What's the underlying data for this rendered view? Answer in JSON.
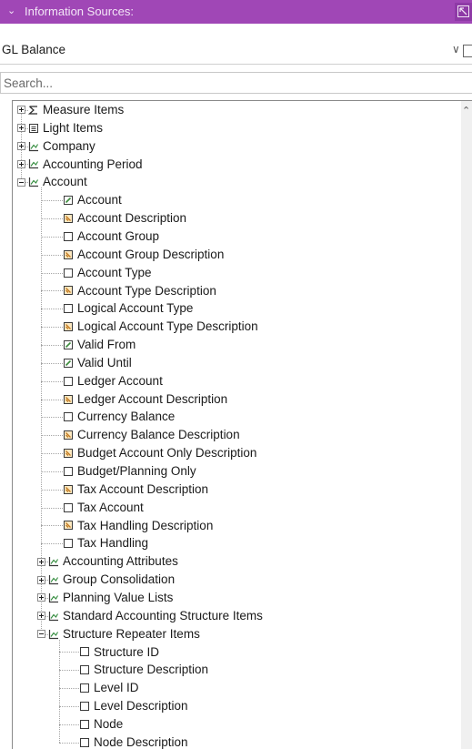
{
  "panel": {
    "title": "Information Sources:",
    "pin_icon": "pin-icon"
  },
  "source_dropdown": {
    "value": "GL Balance"
  },
  "search": {
    "placeholder": "Search..."
  },
  "tree": [
    {
      "label": "Measure Items",
      "icon": "sigma-icon",
      "level": 0,
      "expander": "plus"
    },
    {
      "label": "Light Items",
      "icon": "list-icon",
      "level": 0,
      "expander": "plus"
    },
    {
      "label": "Company",
      "icon": "dimension-icon",
      "level": 0,
      "expander": "plus"
    },
    {
      "label": "Accounting Period",
      "icon": "dimension-icon",
      "level": 0,
      "expander": "plus"
    },
    {
      "label": "Account",
      "icon": "dimension-icon",
      "level": 0,
      "expander": "minus"
    },
    {
      "label": "Account",
      "icon": "green-key-icon",
      "level": 1
    },
    {
      "label": "Account Description",
      "icon": "orange-text-icon",
      "level": 1
    },
    {
      "label": "Account Group",
      "icon": "blank-box-icon",
      "level": 1
    },
    {
      "label": "Account Group Description",
      "icon": "orange-text-icon",
      "level": 1
    },
    {
      "label": "Account Type",
      "icon": "blank-box-icon",
      "level": 1
    },
    {
      "label": "Account Type Description",
      "icon": "orange-text-icon",
      "level": 1
    },
    {
      "label": "Logical Account Type",
      "icon": "blank-box-icon",
      "level": 1
    },
    {
      "label": "Logical Account Type Description",
      "icon": "orange-text-icon",
      "level": 1
    },
    {
      "label": "Valid From",
      "icon": "green-key-icon",
      "level": 1
    },
    {
      "label": "Valid Until",
      "icon": "green-key-icon",
      "level": 1
    },
    {
      "label": "Ledger Account",
      "icon": "blank-box-icon",
      "level": 1
    },
    {
      "label": "Ledger Account Description",
      "icon": "orange-text-icon",
      "level": 1
    },
    {
      "label": "Currency Balance",
      "icon": "blank-box-icon",
      "level": 1
    },
    {
      "label": "Currency Balance Description",
      "icon": "orange-text-icon",
      "level": 1
    },
    {
      "label": "Budget Account Only Description",
      "icon": "orange-text-icon",
      "level": 1
    },
    {
      "label": "Budget/Planning Only",
      "icon": "blank-box-icon",
      "level": 1
    },
    {
      "label": "Tax Account Description",
      "icon": "orange-text-icon",
      "level": 1
    },
    {
      "label": "Tax Account",
      "icon": "blank-box-icon",
      "level": 1
    },
    {
      "label": "Tax Handling Description",
      "icon": "orange-text-icon",
      "level": 1
    },
    {
      "label": "Tax Handling",
      "icon": "blank-box-icon",
      "level": 1
    },
    {
      "label": "Accounting Attributes",
      "icon": "dimension-icon",
      "level": 1,
      "expander": "plus"
    },
    {
      "label": "Group Consolidation",
      "icon": "dimension-icon",
      "level": 1,
      "expander": "plus"
    },
    {
      "label": "Planning Value Lists",
      "icon": "dimension-icon",
      "level": 1,
      "expander": "plus"
    },
    {
      "label": "Standard Accounting Structure Items",
      "icon": "dimension-icon",
      "level": 1,
      "expander": "plus"
    },
    {
      "label": "Structure Repeater Items",
      "icon": "dimension-icon",
      "level": 1,
      "expander": "minus"
    },
    {
      "label": "Structure ID",
      "icon": "blank-box-icon",
      "level": 2
    },
    {
      "label": "Structure Description",
      "icon": "blank-box-icon",
      "level": 2
    },
    {
      "label": "Level ID",
      "icon": "blank-box-icon",
      "level": 2
    },
    {
      "label": "Level Description",
      "icon": "blank-box-icon",
      "level": 2
    },
    {
      "label": "Node",
      "icon": "blank-box-icon",
      "level": 2
    },
    {
      "label": "Node Description",
      "icon": "blank-box-icon",
      "level": 2
    }
  ],
  "colors": {
    "header_bg": "#a047b6",
    "key_icon": "#3c8c3c",
    "text_icon": "#c27a1e"
  }
}
